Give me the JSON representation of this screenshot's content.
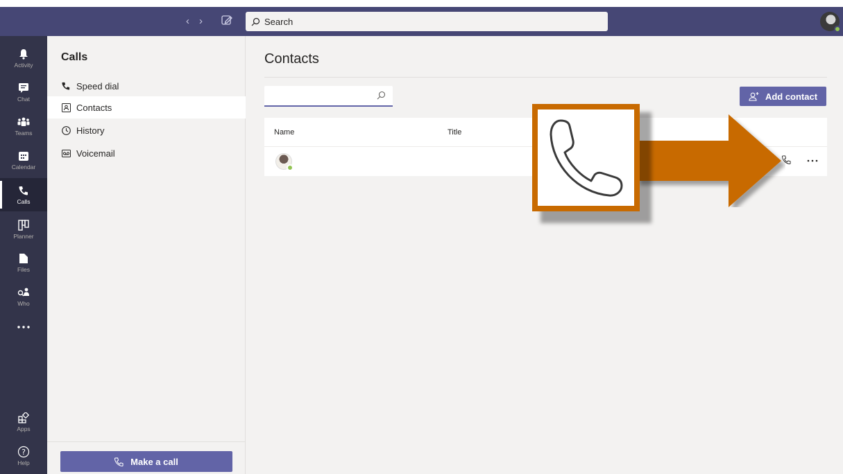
{
  "topbar": {
    "search_placeholder": "Search",
    "back_glyph": "‹",
    "forward_glyph": "›"
  },
  "rail": {
    "items": [
      {
        "label": "Activity",
        "icon": "bell-icon"
      },
      {
        "label": "Chat",
        "icon": "chat-icon"
      },
      {
        "label": "Teams",
        "icon": "teams-icon"
      },
      {
        "label": "Calendar",
        "icon": "calendar-icon"
      },
      {
        "label": "Calls",
        "icon": "phone-icon",
        "active": true
      },
      {
        "label": "Planner",
        "icon": "planner-icon"
      },
      {
        "label": "Files",
        "icon": "file-icon"
      },
      {
        "label": "Who",
        "icon": "who-icon"
      },
      {
        "label": "",
        "icon": "more-icon"
      },
      {
        "label": "Apps",
        "icon": "apps-icon"
      },
      {
        "label": "Help",
        "icon": "help-icon"
      }
    ]
  },
  "calls_panel": {
    "title": "Calls",
    "items": [
      {
        "label": "Speed dial",
        "icon": "phone-icon"
      },
      {
        "label": "Contacts",
        "icon": "contact-card-icon",
        "active": true
      },
      {
        "label": "History",
        "icon": "clock-icon"
      },
      {
        "label": "Voicemail",
        "icon": "voicemail-icon"
      }
    ],
    "make_call_label": "Make a call"
  },
  "main": {
    "title": "Contacts",
    "search_placeholder": "",
    "add_contact_label": "Add contact",
    "columns": [
      "Name",
      "Title"
    ],
    "rows": [
      {
        "name": "",
        "title": "",
        "status": "available"
      }
    ]
  },
  "colors": {
    "brand": "#6264a7",
    "topbar": "#464775",
    "rail": "#33344a",
    "callout": "#c86a00",
    "presence_available": "#92c353"
  }
}
